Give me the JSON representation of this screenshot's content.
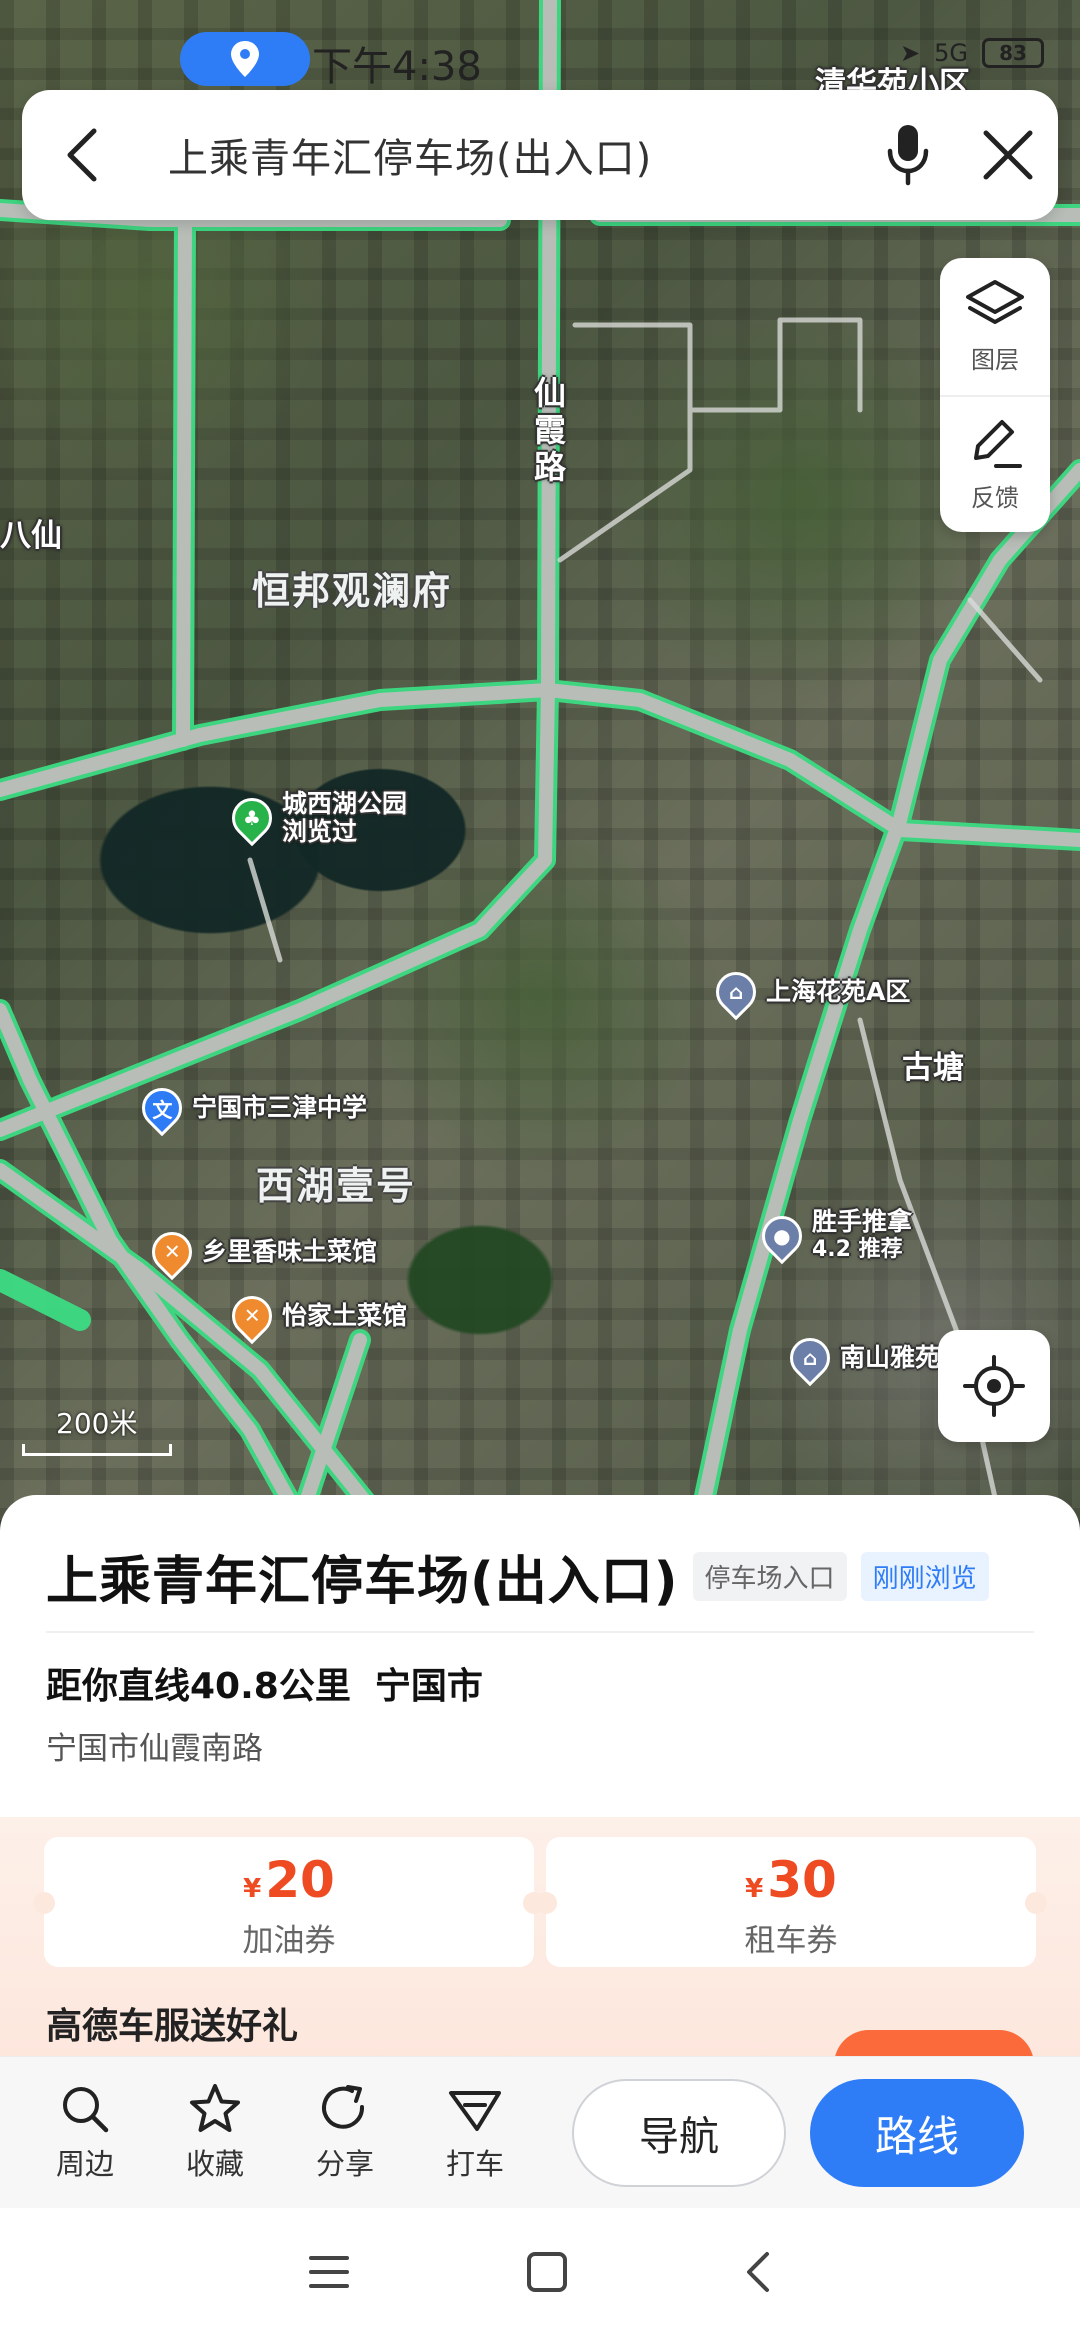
{
  "status_bar": {
    "time": "下午4:38",
    "network": "5G",
    "battery": "83"
  },
  "search": {
    "query": "上乘青年汇停车场(出入口)"
  },
  "map_tools": {
    "layers_label": "图层",
    "feedback_label": "反馈"
  },
  "map": {
    "road_label": "仙\n霞\n路",
    "area_labels": {
      "hengbang": "恒邦观澜府",
      "xihu_yihao": "西湖壹号",
      "gutang": "古塘",
      "baxian": "八仙",
      "qinghua": "清华苑小区"
    },
    "pois": {
      "park_name": "城西湖公园",
      "park_sub": "浏览过",
      "school": "宁国市三津中学",
      "shanghai": "上海花苑A区",
      "restaurant1": "乡里香味土菜馆",
      "restaurant2": "怡家土菜馆",
      "massage_name": "胜手推拿",
      "massage_sub": "4.2 推荐",
      "nanshan": "南山雅苑"
    },
    "scale": "200米"
  },
  "place": {
    "name": "上乘青年汇停车场(出入口)",
    "tag_type": "停车场入口",
    "tag_recent": "刚刚浏览",
    "distance": "距你直线40.8公里",
    "city": "宁国市",
    "address": "宁国市仙霞南路"
  },
  "coupons": [
    {
      "symbol": "¥",
      "amount": "20",
      "name": "加油券"
    },
    {
      "symbol": "¥",
      "amount": "30",
      "name": "租车券"
    }
  ],
  "promo": {
    "title": "高德车服送好礼"
  },
  "actions": {
    "nearby": "周边",
    "favorite": "收藏",
    "share": "分享",
    "taxi": "打车",
    "navigate": "导航",
    "route": "路线"
  },
  "colors": {
    "accent": "#2f7df6",
    "road_highlight": "#3ddc84",
    "coupon_red": "#ee4b22"
  }
}
